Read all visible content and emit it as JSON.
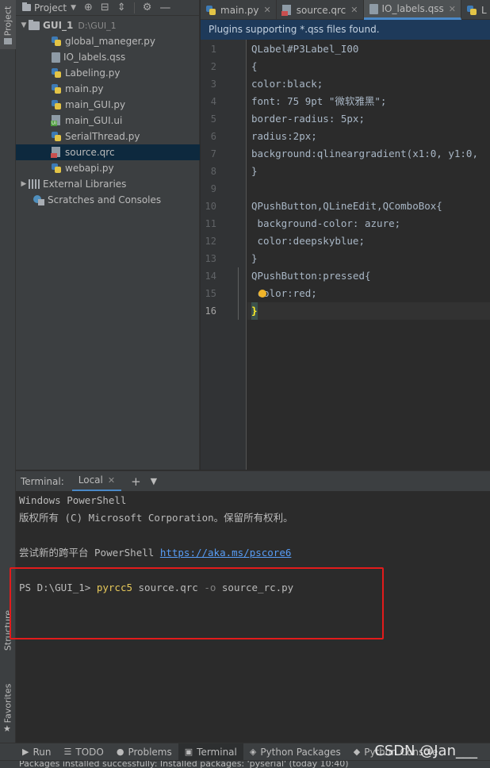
{
  "left_strip": {
    "project_label": "Project",
    "structure_label": "Structure",
    "favorites_label": "Favorites"
  },
  "project_panel": {
    "title": "Project",
    "root": {
      "label": "GUI_1",
      "path": "D:\\GUI_1"
    },
    "files": [
      {
        "name": "global_maneger.py",
        "type": "py"
      },
      {
        "name": "IO_labels.qss",
        "type": "qss"
      },
      {
        "name": "Labeling.py",
        "type": "py"
      },
      {
        "name": "main.py",
        "type": "py"
      },
      {
        "name": "main_GUI.py",
        "type": "py"
      },
      {
        "name": "main_GUI.ui",
        "type": "ui"
      },
      {
        "name": "SerialThread.py",
        "type": "py"
      },
      {
        "name": "source.qrc",
        "type": "qrc",
        "selected": true
      },
      {
        "name": "webapi.py",
        "type": "py"
      }
    ],
    "external_libraries": "External Libraries",
    "scratches": "Scratches and Consoles"
  },
  "editor_tabs": [
    {
      "label": "main.py",
      "type": "py",
      "active": false
    },
    {
      "label": "source.qrc",
      "type": "qrc",
      "active": false
    },
    {
      "label": "IO_labels.qss",
      "type": "qss",
      "active": true
    },
    {
      "label": "L",
      "type": "py",
      "active": false
    }
  ],
  "notification": "Plugins supporting *.qss files found.",
  "editor": {
    "current_line": 16,
    "lines": [
      "QLabel#P3Label_I00",
      "{",
      "color:black;",
      "font: 75 9pt \"微软雅黑\";",
      "border-radius: 5px;",
      "radius:2px;",
      "background:qlineargradient(x1:0, y1:0,",
      "}",
      "",
      "QPushButton,QLineEdit,QComboBox{",
      " background-color: azure;",
      " color:deepskyblue;",
      "}",
      "QPushButton:pressed{",
      " color:red;",
      "}"
    ]
  },
  "terminal": {
    "label": "Terminal:",
    "tab": "Local",
    "line1": "Windows PowerShell",
    "line2": "版权所有 (C) Microsoft Corporation。保留所有权利。",
    "line3_prefix": "尝试新的跨平台 PowerShell ",
    "line3_link": "https://aka.ms/pscore6",
    "prompt": "PS D:\\GUI_1> ",
    "cmd": "pyrcc5",
    "arg1": " source.qrc ",
    "flag": "-o",
    "arg2": " source_rc.py"
  },
  "bottom_tools": [
    {
      "label": "Run",
      "icon": "play-icon"
    },
    {
      "label": "TODO",
      "icon": "list-icon"
    },
    {
      "label": "Problems",
      "icon": "warning-icon"
    },
    {
      "label": "Terminal",
      "icon": "terminal-icon",
      "active": true
    },
    {
      "label": "Python Packages",
      "icon": "packages-icon"
    },
    {
      "label": "Python Console",
      "icon": "python-icon"
    }
  ],
  "watermark": "CSDN @Jan___",
  "status_bar": "Packages installed successfully: Installed packages: 'pyserial' (today 10:40)",
  "colors": {
    "accent": "#4a88c7",
    "highlight_box": "#e21b1b",
    "link": "#589df6"
  }
}
